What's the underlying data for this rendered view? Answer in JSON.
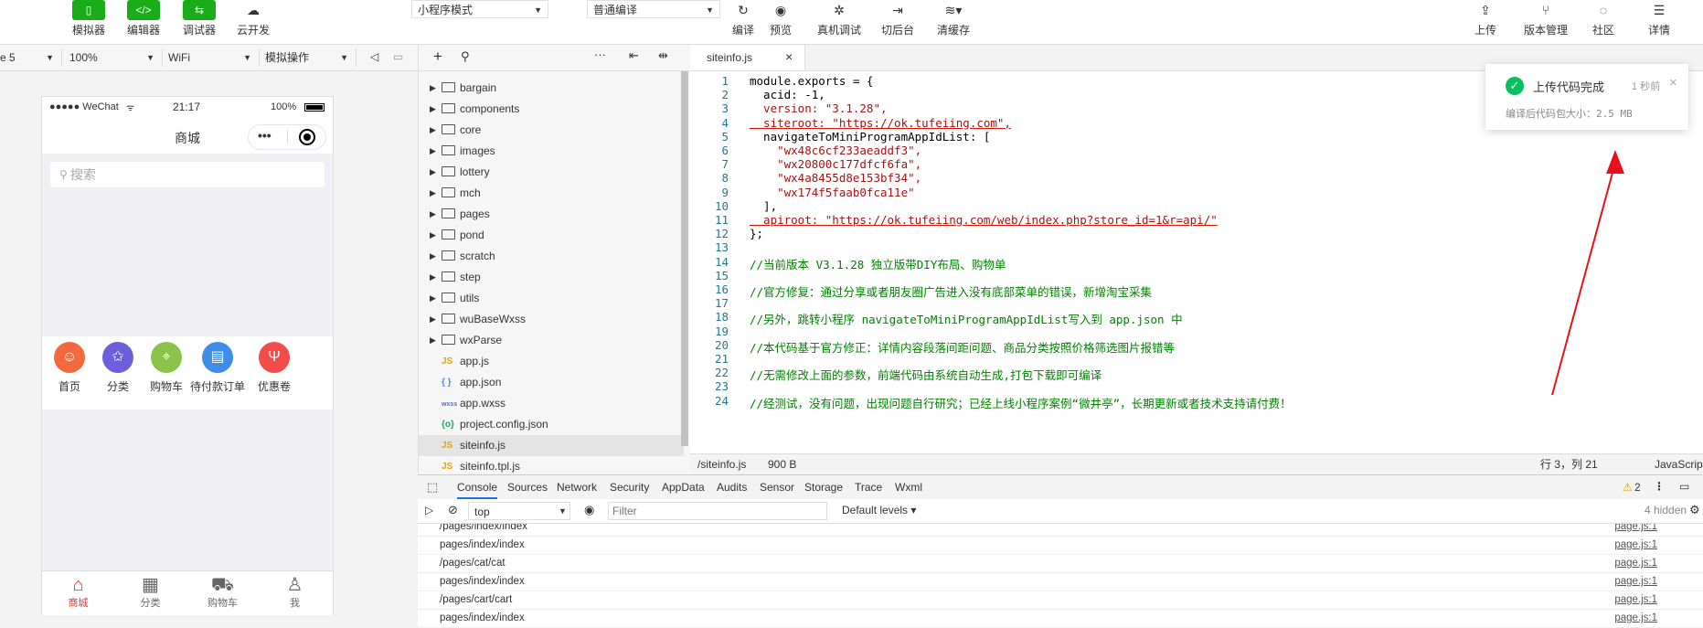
{
  "toolbar": {
    "left_buttons": [
      {
        "label": "模拟器",
        "icon": "phone-icon"
      },
      {
        "label": "编辑器",
        "icon": "code-icon"
      },
      {
        "label": "调试器",
        "icon": "debug-icon"
      },
      {
        "label": "云开发",
        "icon": "cloud-icon"
      }
    ],
    "mode_select": "小程序模式",
    "compile_select": "普通编译",
    "center_buttons": [
      {
        "label": "编译",
        "icon": "refresh-icon"
      },
      {
        "label": "预览",
        "icon": "eye-icon"
      },
      {
        "label": "真机调试",
        "icon": "bug-icon"
      },
      {
        "label": "切后台",
        "icon": "background-icon"
      },
      {
        "label": "清缓存",
        "icon": "layers-icon"
      }
    ],
    "right_buttons": [
      {
        "label": "上传",
        "icon": "upload-icon"
      },
      {
        "label": "版本管理",
        "icon": "branch-icon"
      },
      {
        "label": "社区",
        "icon": "chat-icon"
      },
      {
        "label": "详情",
        "icon": "menu-icon"
      }
    ]
  },
  "simbar": {
    "device": "e 5",
    "zoom": "100%",
    "network": "WiFi",
    "operation": "模拟操作"
  },
  "phone": {
    "status_left": "●●●●● WeChat",
    "time": "21:17",
    "battery": "100%",
    "nav_title": "商城",
    "search_placeholder": "搜索",
    "categories": [
      {
        "label": "首页",
        "color": "#f4693c",
        "icon": "home-icon"
      },
      {
        "label": "分类",
        "color": "#6c5fd9",
        "icon": "star-icon"
      },
      {
        "label": "购物车",
        "color": "#8bc34a",
        "icon": "location-icon"
      },
      {
        "label": "待付款订单",
        "color": "#3d8ee8",
        "icon": "doc-icon"
      },
      {
        "label": "优惠卷",
        "color": "#f44b4b",
        "icon": "utensils-icon"
      }
    ],
    "tabs": [
      {
        "label": "商城",
        "glyph": "⌂"
      },
      {
        "label": "分类",
        "glyph": "▦"
      },
      {
        "label": "购物车",
        "glyph": "⛟"
      },
      {
        "label": "我",
        "glyph": "♙"
      }
    ]
  },
  "files": [
    {
      "name": "bargain",
      "type": "folder"
    },
    {
      "name": "components",
      "type": "folder"
    },
    {
      "name": "core",
      "type": "folder"
    },
    {
      "name": "images",
      "type": "folder"
    },
    {
      "name": "lottery",
      "type": "folder"
    },
    {
      "name": "mch",
      "type": "folder"
    },
    {
      "name": "pages",
      "type": "folder"
    },
    {
      "name": "pond",
      "type": "folder"
    },
    {
      "name": "scratch",
      "type": "folder"
    },
    {
      "name": "step",
      "type": "folder"
    },
    {
      "name": "utils",
      "type": "folder"
    },
    {
      "name": "wuBaseWxss",
      "type": "folder"
    },
    {
      "name": "wxParse",
      "type": "folder"
    },
    {
      "name": "app.js",
      "type": "js",
      "badge": "JS"
    },
    {
      "name": "app.json",
      "type": "json",
      "badge": "{ }"
    },
    {
      "name": "app.wxss",
      "type": "wxss",
      "badge": "wxss"
    },
    {
      "name": "project.config.json",
      "type": "config",
      "badge": "{o}"
    },
    {
      "name": "siteinfo.js",
      "type": "js",
      "badge": "JS"
    },
    {
      "name": "siteinfo.tpl.js",
      "type": "js",
      "badge": "JS"
    }
  ],
  "editor": {
    "tab_name": "siteinfo.js",
    "lines": [
      {
        "n": "1",
        "text": "module.exports = {"
      },
      {
        "n": "2",
        "text": "  acid: -1,"
      },
      {
        "n": "3",
        "text": "  version: \"3.1.28\","
      },
      {
        "n": "4",
        "text": "  siteroot: \"https://ok.tufeiing.com\","
      },
      {
        "n": "5",
        "text": "  navigateToMiniProgramAppIdList: ["
      },
      {
        "n": "6",
        "text": "    \"wx48c6cf233aeaddf3\","
      },
      {
        "n": "7",
        "text": "    \"wx20800c177dfcf6fa\","
      },
      {
        "n": "8",
        "text": "    \"wx4a8455d8e153bf34\","
      },
      {
        "n": "9",
        "text": "    \"wx174f5faab0fca11e\""
      },
      {
        "n": "10",
        "text": "  ],"
      },
      {
        "n": "11",
        "text": "  apiroot: \"https://ok.tufeiing.com/web/index.php?store_id=1&r=api/\""
      },
      {
        "n": "12",
        "text": "};"
      },
      {
        "n": "13",
        "text": ""
      },
      {
        "n": "14",
        "text": "//当前版本 V3.1.28 独立版带DIY布局、购物单"
      },
      {
        "n": "15",
        "text": ""
      },
      {
        "n": "16",
        "text": "//官方修复：通过分享或者朋友圈广告进入没有底部菜单的错误，新增淘宝采集"
      },
      {
        "n": "17",
        "text": ""
      },
      {
        "n": "18",
        "text": "//另外，跳转小程序 navigateToMiniProgramAppIdList写入到 app.json 中"
      },
      {
        "n": "19",
        "text": ""
      },
      {
        "n": "20",
        "text": "//本代码基于官方修正：详情内容段落间距问题、商品分类按照价格筛选图片报错等"
      },
      {
        "n": "21",
        "text": ""
      },
      {
        "n": "22",
        "text": "//无需修改上面的参数，前端代码由系统自动生成,打包下载即可编译"
      },
      {
        "n": "23",
        "text": ""
      },
      {
        "n": "24",
        "text": "//经测试，没有问题，出现问题自行研究；已经上线小程序案例“微井亭”，长期更新或者技术支持请付费！"
      }
    ],
    "status_path": "/siteinfo.js",
    "status_size": "900 B",
    "status_pos": "行 3，列 21",
    "status_lang": "JavaScript"
  },
  "console": {
    "tabs": [
      "Console",
      "Sources",
      "Network",
      "Security",
      "AppData",
      "Audits",
      "Sensor",
      "Storage",
      "Trace",
      "Wxml"
    ],
    "warn_count": "2",
    "context": "top",
    "filter_placeholder": "Filter",
    "levels": "Default levels",
    "hidden": "4 hidden",
    "rows": [
      {
        "msg": "/pages/index/index",
        "src": "page.js:1"
      },
      {
        "msg": "pages/index/index",
        "src": "page.js:1"
      },
      {
        "msg": "/pages/cat/cat",
        "src": "page.js:1"
      },
      {
        "msg": "pages/index/index",
        "src": "page.js:1"
      },
      {
        "msg": "/pages/cart/cart",
        "src": "page.js:1"
      },
      {
        "msg": "pages/index/index",
        "src": "page.js:1"
      }
    ]
  },
  "toast": {
    "title": "上传代码完成",
    "time": "1 秒前",
    "detail": "编译后代码包大小：2.5 MB"
  },
  "colors": {
    "accent_green": "#1aad19",
    "success": "#07c160",
    "arrow_red": "#e8101a"
  }
}
